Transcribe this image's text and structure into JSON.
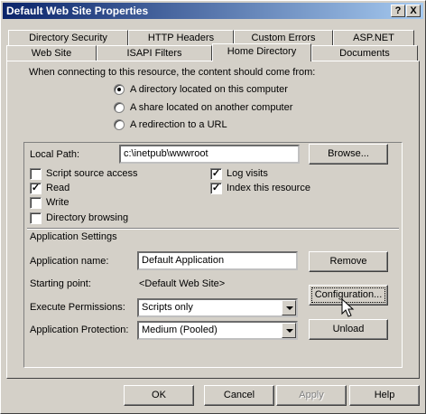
{
  "window": {
    "title": "Default Web Site Properties",
    "help_btn": "?",
    "close_btn": "X"
  },
  "tabs": {
    "back": [
      "Directory Security",
      "HTTP Headers",
      "Custom Errors",
      "ASP.NET"
    ],
    "front": [
      "Web Site",
      "ISAPI Filters",
      "Home Directory",
      "Documents"
    ],
    "active": "Home Directory"
  },
  "content_source": {
    "prompt": "When connecting to this resource, the content should come from:",
    "options": [
      {
        "label": "A directory located on this computer",
        "selected": true
      },
      {
        "label": "A share located on another computer",
        "selected": false
      },
      {
        "label": "A redirection to a URL",
        "selected": false
      }
    ]
  },
  "local_path": {
    "label": "Local Path:",
    "value": "c:\\inetpub\\wwwroot",
    "browse": "Browse..."
  },
  "permissions": {
    "script_source_access": {
      "label": "Script source access",
      "checked": false
    },
    "read": {
      "label": "Read",
      "checked": true
    },
    "write": {
      "label": "Write",
      "checked": false
    },
    "directory_browsing": {
      "label": "Directory browsing",
      "checked": false
    },
    "log_visits": {
      "label": "Log visits",
      "checked": true
    },
    "index_resource": {
      "label": "Index this resource",
      "checked": true
    }
  },
  "app_settings": {
    "heading": "Application Settings",
    "app_name_label": "Application name:",
    "app_name_value": "Default Application",
    "remove": "Remove",
    "starting_point_label": "Starting point:",
    "starting_point_value": "<Default Web Site>",
    "configuration": "Configuration...",
    "execute_label": "Execute Permissions:",
    "execute_value": "Scripts only",
    "protection_label": "Application Protection:",
    "protection_value": "Medium (Pooled)",
    "unload": "Unload"
  },
  "footer": {
    "ok": "OK",
    "cancel": "Cancel",
    "apply": "Apply",
    "help": "Help"
  }
}
